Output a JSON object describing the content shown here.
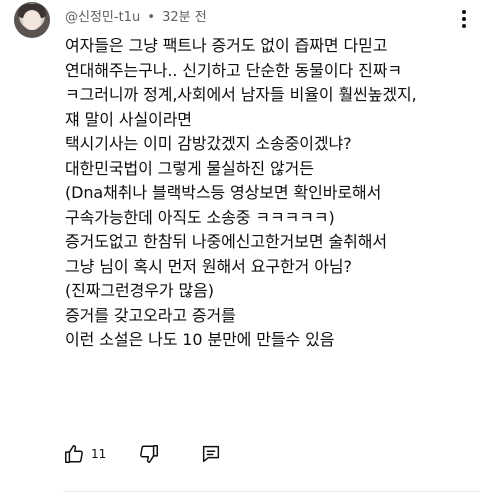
{
  "comment": {
    "handle": "@신정민-t1u",
    "separator": "•",
    "time": "32분 전",
    "lines": [
      "여자들은 그냥 팩트나 증거도 없이 즙짜면 다믿고",
      "연대해주는구나.. 신기하고 단순한 동물이다 진짜ㅋ",
      "ㅋ그러니까 정계,사회에서 남자들 비율이 훨씬높겠지,",
      "쟤 말이 사실이라면",
      "택시기사는 이미 감방갔겠지 소송중이겠냐?",
      "대한민국법이 그렇게 물실하진 않거든",
      "(Dna채취나 블랙박스등 영상보면 확인바로해서",
      "구속가능한데 아직도 소송중 ㅋㅋㅋㅋㅋ)",
      "증거도없고 한참뒤 나중에신고한거보면 술취해서",
      "그냥 님이 혹시 먼저 원해서 요구한거 아님?",
      "(진짜그런경우가 많음)",
      "증거를 갖고오라고 증거를",
      "이런 소설은 나도 10 분만에 만들수 있음"
    ],
    "like_count": "11"
  },
  "icons": {
    "more": "more-vert-icon",
    "like": "thumbs-up-icon",
    "dislike": "thumbs-down-icon",
    "reply": "comment-reply-icon"
  },
  "colors": {
    "text": "#0f0f0f",
    "meta": "#606060",
    "divider": "#e5e5e5"
  }
}
